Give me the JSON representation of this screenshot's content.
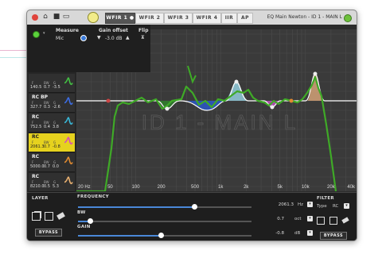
{
  "window": {
    "title": "EQ Main Newton - ID 1 - MAIN L",
    "tabs": [
      {
        "label": "WFIR 1 ●",
        "active": true
      },
      {
        "label": "WFIR 2",
        "active": false
      },
      {
        "label": "WFIR 3",
        "active": false
      },
      {
        "label": "WFIR 4",
        "active": false
      },
      {
        "label": "IIR",
        "active": false
      },
      {
        "label": "AP",
        "active": false
      }
    ]
  },
  "measure": {
    "measure_label": "Measure",
    "gain_offset_label": "Gain offset",
    "flip_label": "Flip",
    "source_value": "Mic",
    "gain_offset_value": "-3.0 dB"
  },
  "filters": [
    {
      "name": "",
      "f_label": "F",
      "bw_label": "BW",
      "g_label": "G",
      "f": "140.5",
      "bw": "0.7",
      "g": "-3.5",
      "color": "#43c043"
    },
    {
      "name": "RC BP",
      "f_label": "F",
      "bw_label": "BW",
      "g_label": "G",
      "f": "327.7",
      "bw": "0.3",
      "g": "-2.6",
      "color": "#3c6ee6"
    },
    {
      "name": "RC",
      "f_label": "F",
      "bw_label": "BW",
      "g_label": "G",
      "f": "752.5",
      "bw": "0.4",
      "g": "3.8",
      "color": "#39b8d8"
    },
    {
      "name": "RC",
      "f_label": "F",
      "bw_label": "BW",
      "g_label": "G",
      "f": "2061.3",
      "bw": "0.7",
      "g": "-0.8",
      "color": "#d850b8",
      "selected": true
    },
    {
      "name": "RC",
      "f_label": "F",
      "bw_label": "BW",
      "g_label": "G",
      "f": "5000.0",
      "bw": "0.7",
      "g": "0.0",
      "color": "#e08a30"
    },
    {
      "name": "RC",
      "f_label": "F",
      "bw_label": "BW",
      "g_label": "G",
      "f": "8210.0",
      "bw": "0.5",
      "g": "5.3",
      "color": "#e8b070"
    }
  ],
  "graph": {
    "x_ticks": [
      "20 Hz",
      "50",
      "100",
      "200",
      "500",
      "1k",
      "2k",
      "5k",
      "10k",
      "20k",
      "40k"
    ],
    "watermark": "ID 1 - MAIN L",
    "colors": {
      "response": "#3faa27",
      "target": "#ffffff",
      "grid": "#4b4b4b"
    }
  },
  "bottom": {
    "layer_label": "LAYER",
    "frequency_label": "FREQUENCY",
    "frequency_value": "2061.3",
    "frequency_unit": "Hz",
    "frequency_level": 0.67,
    "bw_label": "BW",
    "bw_value": "0.7",
    "bw_unit": "oct",
    "bw_level": 0.07,
    "gain_label": "GAIN",
    "gain_value": "-0.8",
    "gain_unit": "dB",
    "gain_level": 0.48,
    "bypass_label": "BYPASS",
    "filter_label": "FILTER",
    "type_label": "Type",
    "type_value": "RC",
    "bypass_label_right": "BYPASS"
  }
}
